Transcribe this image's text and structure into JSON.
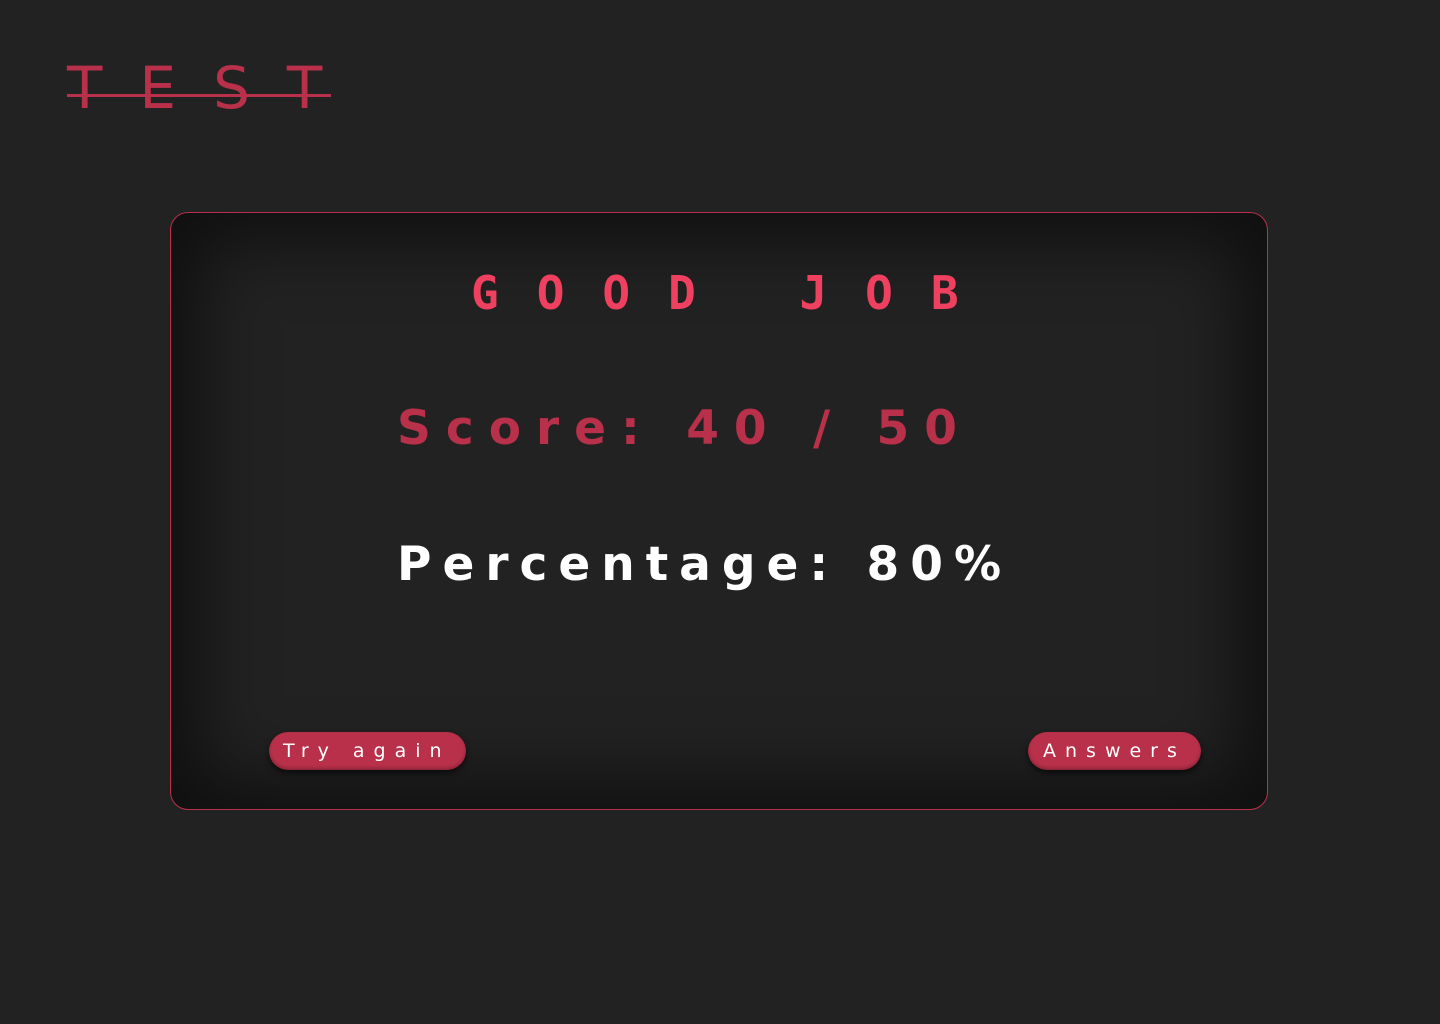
{
  "header": {
    "logo_text": "TEST"
  },
  "result": {
    "headline": "GOOD JOB",
    "score_label": "Score: 40 / 50",
    "percentage_label": "Percentage: 80%"
  },
  "actions": {
    "try_again_label": "Try again",
    "answers_label": "Answers"
  },
  "colors": {
    "background": "#222222",
    "accent": "#b8304a",
    "headline": "#f0405f",
    "text_light": "#ffffff"
  }
}
